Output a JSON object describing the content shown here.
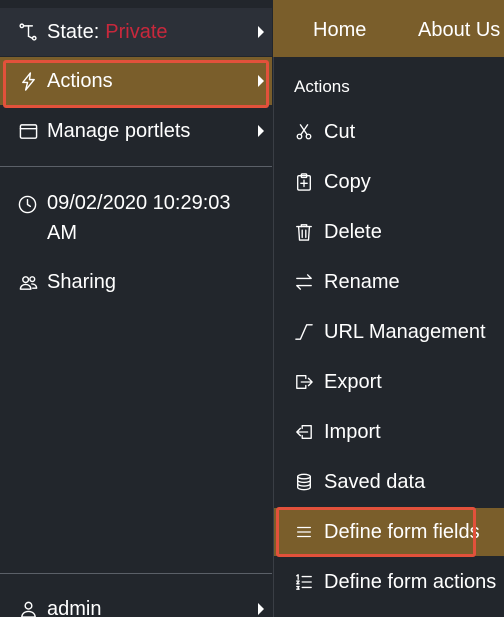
{
  "topnav": {
    "home": "Home",
    "about": "About Us"
  },
  "sidebar": {
    "state_label": "State:",
    "state_value": "Private",
    "actions_label": "Actions",
    "manage_portlets_label": "Manage portlets",
    "modified_date": "09/02/2020 10:29:03 AM",
    "sharing_label": "Sharing",
    "user_label": "admin"
  },
  "actions_menu": {
    "heading": "Actions",
    "items": [
      {
        "label": "Cut",
        "icon": "scissors-icon"
      },
      {
        "label": "Copy",
        "icon": "clipboard-plus-icon"
      },
      {
        "label": "Delete",
        "icon": "trash-icon"
      },
      {
        "label": "Rename",
        "icon": "arrows-left-right-icon"
      },
      {
        "label": "URL Management",
        "icon": "url-management-icon"
      },
      {
        "label": "Export",
        "icon": "box-arrow-right-icon"
      },
      {
        "label": "Import",
        "icon": "box-arrow-in-left-icon"
      },
      {
        "label": "Saved data",
        "icon": "database-icon"
      },
      {
        "label": "Define form fields",
        "icon": "list-icon",
        "active": true
      },
      {
        "label": "Define form actions",
        "icon": "list-ol-icon"
      }
    ]
  },
  "colors": {
    "background": "#22262c",
    "accent": "#7a5e2b",
    "state_private": "#c8283c",
    "highlight_border": "#e2513b"
  }
}
